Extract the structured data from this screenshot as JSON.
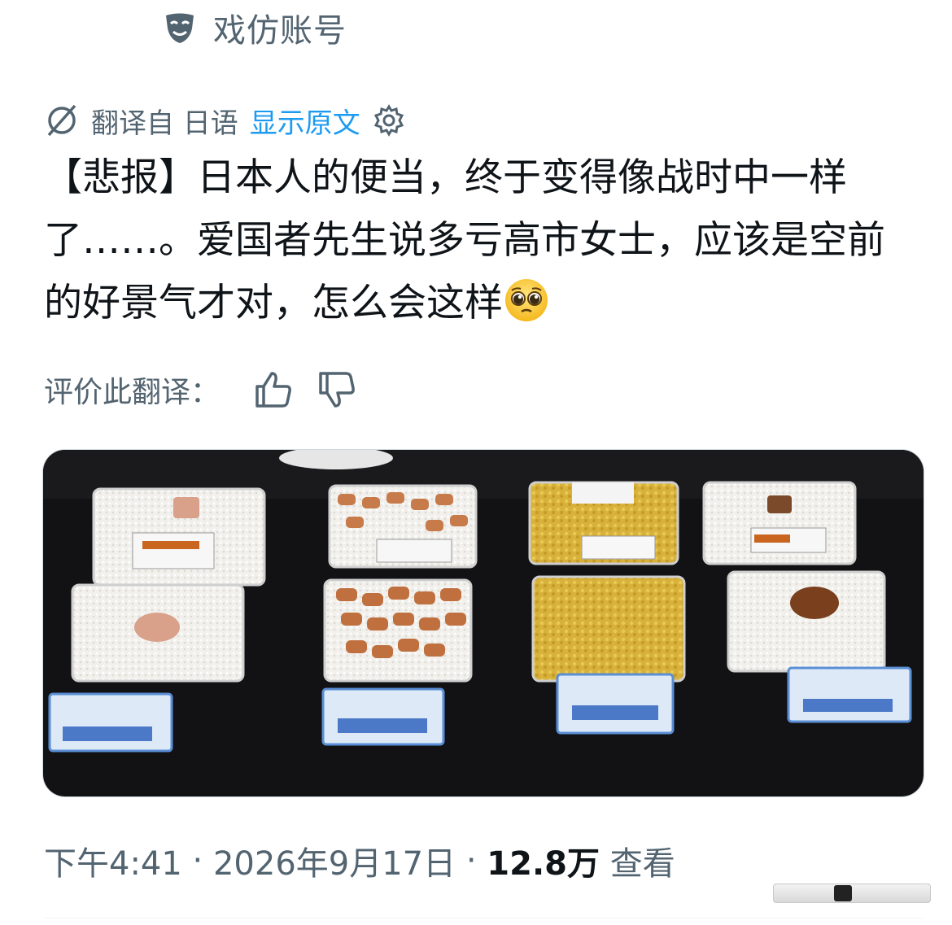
{
  "account": {
    "label": "戏仿账号",
    "icon": "theater-mask-icon"
  },
  "translation": {
    "label": "翻译自 日语",
    "show_original": "显示原文",
    "settings_icon": "gear-icon",
    "translate_icon": "translate-icon"
  },
  "post": {
    "text": "【悲报】日本人的便当，终于变得像战时中一样了……。爱国者先生说多亏高市女士，应该是空前的好景气才对，怎么会这样",
    "emoji": "pleading-face-emoji"
  },
  "rate": {
    "label": "评价此翻译：",
    "like_icon": "thumbs-up-icon",
    "dislike_icon": "thumbs-down-icon"
  },
  "media": {
    "description_icon": "photo"
  },
  "meta": {
    "time": "下午4:41",
    "separator": " · ",
    "date": "2026年9月17日",
    "views_count": "12.8万",
    "views_label": "查看"
  },
  "colors": {
    "link": "#1d9bf0",
    "secondary_text": "#536471",
    "primary_text": "#0f1419"
  }
}
